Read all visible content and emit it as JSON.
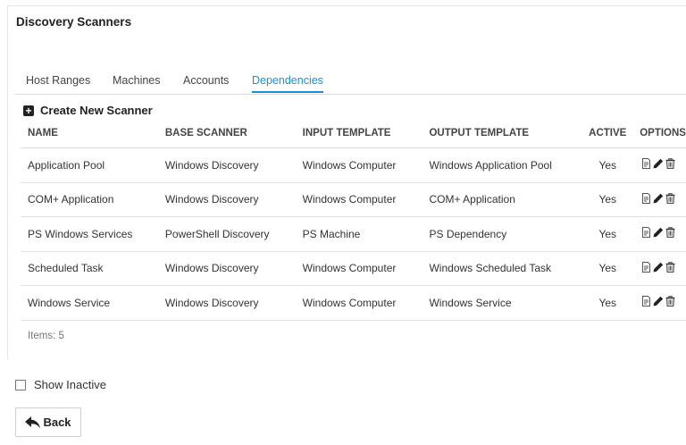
{
  "page": {
    "title": "Discovery Scanners"
  },
  "tabs": [
    {
      "label": "Host Ranges",
      "active": false
    },
    {
      "label": "Machines",
      "active": false
    },
    {
      "label": "Accounts",
      "active": false
    },
    {
      "label": "Dependencies",
      "active": true
    }
  ],
  "create_button": {
    "label": "Create New Scanner",
    "icon": "plus-square-icon"
  },
  "table": {
    "headers": [
      "NAME",
      "BASE SCANNER",
      "INPUT TEMPLATE",
      "OUTPUT TEMPLATE",
      "ACTIVE",
      "OPTIONS"
    ],
    "rows": [
      {
        "name": "Application Pool",
        "base_scanner": "Windows Discovery",
        "input_template": "Windows Computer",
        "output_template": "Windows Application Pool",
        "active": "Yes"
      },
      {
        "name": "COM+ Application",
        "base_scanner": "Windows Discovery",
        "input_template": "Windows Computer",
        "output_template": "COM+ Application",
        "active": "Yes"
      },
      {
        "name": "PS Windows Services",
        "base_scanner": "PowerShell Discovery",
        "input_template": "PS Machine",
        "output_template": "PS Dependency",
        "active": "Yes"
      },
      {
        "name": "Scheduled Task",
        "base_scanner": "Windows Discovery",
        "input_template": "Windows Computer",
        "output_template": "Windows Scheduled Task",
        "active": "Yes"
      },
      {
        "name": "Windows Service",
        "base_scanner": "Windows Discovery",
        "input_template": "Windows Computer",
        "output_template": "Windows Service",
        "active": "Yes"
      }
    ],
    "option_icons": [
      "copy-icon",
      "pencil-icon",
      "trash-icon"
    ]
  },
  "items_count": "Items: 5",
  "show_inactive": {
    "label": "Show Inactive",
    "checked": false
  },
  "back_button": {
    "label": "Back",
    "icon": "reply-arrow-icon"
  },
  "colors": {
    "accent": "#1a8fd6",
    "text": "#333333",
    "border": "#dcdcdc"
  }
}
